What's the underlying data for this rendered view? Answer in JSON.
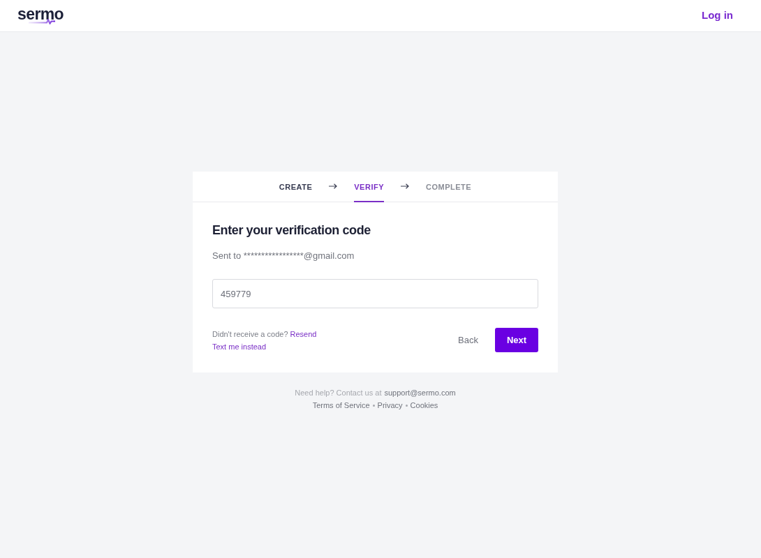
{
  "header": {
    "logo": "sermo",
    "login_link": "Log in"
  },
  "steps": [
    {
      "label": "CREATE",
      "selected": false,
      "completed": true
    },
    {
      "label": "VERIFY",
      "selected": true,
      "completed": false
    },
    {
      "label": "COMPLETE",
      "selected": false,
      "completed": false
    }
  ],
  "form": {
    "title": "Enter your verification code",
    "sent_to": "Sent to *****************@gmail.com",
    "code_field": {
      "value": "459779"
    },
    "resend_prompt": "Didn't receive a code?",
    "resend_link": "Resend",
    "text_link": "Text me instead",
    "back_button": "Back",
    "next_button": "Next"
  },
  "footer": {
    "help_text": "Need help? Contact us at",
    "support_link": "support@sermo.com",
    "links": [
      "Terms of Service",
      "Privacy",
      "Cookies"
    ]
  }
}
